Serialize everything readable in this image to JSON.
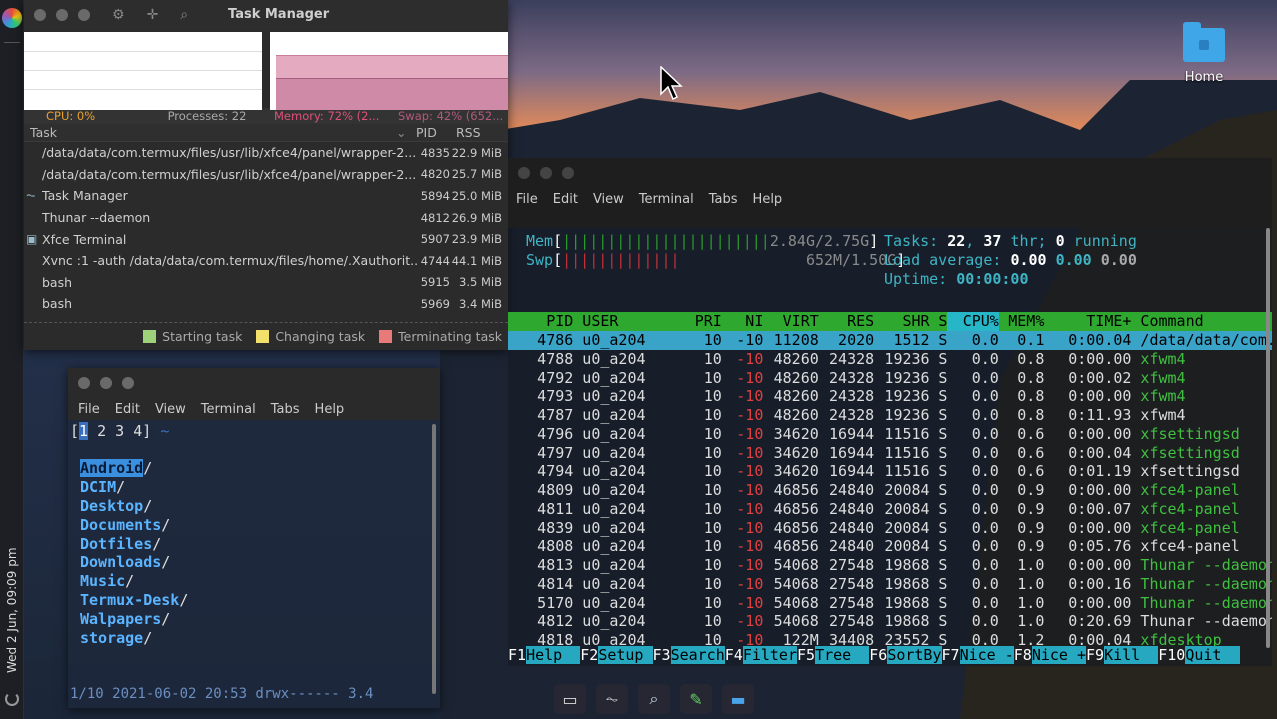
{
  "desktop": {
    "home_label": "Home"
  },
  "panel": {
    "clock": "Wed 2 Jun, 09:09 pm"
  },
  "taskmanager": {
    "title": "Task Manager",
    "status": {
      "cpu": "CPU: 0%",
      "processes": "Processes: 22",
      "memory": "Memory: 72% (2...",
      "swap": "Swap: 42% (652..."
    },
    "memory_fraction": 0.72,
    "swap_fraction": 0.42,
    "columns": {
      "task": "Task",
      "pid": "PID",
      "rss": "RSS"
    },
    "rows": [
      {
        "icon": "",
        "name": "/data/data/com.termux/files/usr/lib/xfce4/panel/wrapper-2...",
        "pid": "4835",
        "rss": "22.9 MiB"
      },
      {
        "icon": "",
        "name": "/data/data/com.termux/files/usr/lib/xfce4/panel/wrapper-2...",
        "pid": "4820",
        "rss": "25.7 MiB"
      },
      {
        "icon": "task-manager-icon",
        "name": "Task Manager",
        "pid": "5894",
        "rss": "25.0 MiB"
      },
      {
        "icon": "",
        "name": "Thunar --daemon",
        "pid": "4812",
        "rss": "26.9 MiB"
      },
      {
        "icon": "terminal-icon",
        "name": "Xfce Terminal",
        "pid": "5907",
        "rss": "23.9 MiB"
      },
      {
        "icon": "",
        "name": "Xvnc :1 -auth /data/data/com.termux/files/home/.Xauthorit...",
        "pid": "4744",
        "rss": "44.1 MiB"
      },
      {
        "icon": "",
        "name": "bash",
        "pid": "5915",
        "rss": "3.5 MiB"
      },
      {
        "icon": "",
        "name": "bash",
        "pid": "5969",
        "rss": "3.4 MiB"
      }
    ],
    "legend": {
      "starting": "Starting task",
      "changing": "Changing task",
      "terminating": "Terminating task",
      "colors": {
        "starting": "#9ed27a",
        "changing": "#f2e06a",
        "terminating": "#e87a7a"
      }
    }
  },
  "terminal_small": {
    "menu": [
      "File",
      "Edit",
      "View",
      "Terminal",
      "Tabs",
      "Help"
    ],
    "tabs": [
      "1",
      "2",
      "3",
      "4"
    ],
    "tab_suffix": "~",
    "dirs": [
      "Android",
      "DCIM",
      "Desktop",
      "Documents",
      "Dotfiles",
      "Downloads",
      "Music",
      "Termux-Desk",
      "Walpapers",
      "storage"
    ],
    "status": "1/10 2021-06-02 20:53 drwx------ 3.4"
  },
  "htop": {
    "menu": [
      "File",
      "Edit",
      "View",
      "Terminal",
      "Tabs",
      "Help"
    ],
    "mem": {
      "label": "Mem",
      "value": "2.84G/2.75G"
    },
    "swp": {
      "label": "Swp",
      "value": "652M/1.50G"
    },
    "tasks": {
      "label": "Tasks:",
      "count": "22",
      "thr": "37",
      "thr_label": "thr;",
      "running": "0",
      "running_label": "running"
    },
    "load": {
      "label": "Load average:",
      "v1": "0.00",
      "v2": "0.00",
      "v3": "0.00"
    },
    "uptime": {
      "label": "Uptime:",
      "value": "00:00:00"
    },
    "columns": [
      "PID",
      "USER",
      "PRI",
      "NI",
      "VIRT",
      "RES",
      "SHR",
      "S",
      "CPU%",
      "MEM%",
      "TIME+",
      "Command"
    ],
    "processes": [
      {
        "pid": "4786",
        "user": "u0_a204",
        "pri": "10",
        "ni": "-10",
        "virt": "11208",
        "res": "2020",
        "shr": "1512",
        "s": "S",
        "cpu": "0.0",
        "mem": "0.1",
        "time": "0:00.04",
        "cmd": "/data/data/com.",
        "cmd_color": "white"
      },
      {
        "pid": "4788",
        "user": "u0_a204",
        "pri": "10",
        "ni": "-10",
        "virt": "48260",
        "res": "24328",
        "shr": "19236",
        "s": "S",
        "cpu": "0.0",
        "mem": "0.8",
        "time": "0:00.00",
        "cmd": "xfwm4",
        "cmd_color": "green"
      },
      {
        "pid": "4792",
        "user": "u0_a204",
        "pri": "10",
        "ni": "-10",
        "virt": "48260",
        "res": "24328",
        "shr": "19236",
        "s": "S",
        "cpu": "0.0",
        "mem": "0.8",
        "time": "0:00.02",
        "cmd": "xfwm4",
        "cmd_color": "green"
      },
      {
        "pid": "4793",
        "user": "u0_a204",
        "pri": "10",
        "ni": "-10",
        "virt": "48260",
        "res": "24328",
        "shr": "19236",
        "s": "S",
        "cpu": "0.0",
        "mem": "0.8",
        "time": "0:00.00",
        "cmd": "xfwm4",
        "cmd_color": "green"
      },
      {
        "pid": "4787",
        "user": "u0_a204",
        "pri": "10",
        "ni": "-10",
        "virt": "48260",
        "res": "24328",
        "shr": "19236",
        "s": "S",
        "cpu": "0.0",
        "mem": "0.8",
        "time": "0:11.93",
        "cmd": "xfwm4",
        "cmd_color": "white"
      },
      {
        "pid": "4796",
        "user": "u0_a204",
        "pri": "10",
        "ni": "-10",
        "virt": "34620",
        "res": "16944",
        "shr": "11516",
        "s": "S",
        "cpu": "0.0",
        "mem": "0.6",
        "time": "0:00.00",
        "cmd": "xfsettingsd",
        "cmd_color": "green"
      },
      {
        "pid": "4797",
        "user": "u0_a204",
        "pri": "10",
        "ni": "-10",
        "virt": "34620",
        "res": "16944",
        "shr": "11516",
        "s": "S",
        "cpu": "0.0",
        "mem": "0.6",
        "time": "0:00.04",
        "cmd": "xfsettingsd",
        "cmd_color": "green"
      },
      {
        "pid": "4794",
        "user": "u0_a204",
        "pri": "10",
        "ni": "-10",
        "virt": "34620",
        "res": "16944",
        "shr": "11516",
        "s": "S",
        "cpu": "0.0",
        "mem": "0.6",
        "time": "0:01.19",
        "cmd": "xfsettingsd",
        "cmd_color": "white"
      },
      {
        "pid": "4809",
        "user": "u0_a204",
        "pri": "10",
        "ni": "-10",
        "virt": "46856",
        "res": "24840",
        "shr": "20084",
        "s": "S",
        "cpu": "0.0",
        "mem": "0.9",
        "time": "0:00.00",
        "cmd": "xfce4-panel",
        "cmd_color": "green"
      },
      {
        "pid": "4811",
        "user": "u0_a204",
        "pri": "10",
        "ni": "-10",
        "virt": "46856",
        "res": "24840",
        "shr": "20084",
        "s": "S",
        "cpu": "0.0",
        "mem": "0.9",
        "time": "0:00.07",
        "cmd": "xfce4-panel",
        "cmd_color": "green"
      },
      {
        "pid": "4839",
        "user": "u0_a204",
        "pri": "10",
        "ni": "-10",
        "virt": "46856",
        "res": "24840",
        "shr": "20084",
        "s": "S",
        "cpu": "0.0",
        "mem": "0.9",
        "time": "0:00.00",
        "cmd": "xfce4-panel",
        "cmd_color": "green"
      },
      {
        "pid": "4808",
        "user": "u0_a204",
        "pri": "10",
        "ni": "-10",
        "virt": "46856",
        "res": "24840",
        "shr": "20084",
        "s": "S",
        "cpu": "0.0",
        "mem": "0.9",
        "time": "0:05.76",
        "cmd": "xfce4-panel",
        "cmd_color": "white"
      },
      {
        "pid": "4813",
        "user": "u0_a204",
        "pri": "10",
        "ni": "-10",
        "virt": "54068",
        "res": "27548",
        "shr": "19868",
        "s": "S",
        "cpu": "0.0",
        "mem": "1.0",
        "time": "0:00.00",
        "cmd": "Thunar --daemon",
        "cmd_color": "green"
      },
      {
        "pid": "4814",
        "user": "u0_a204",
        "pri": "10",
        "ni": "-10",
        "virt": "54068",
        "res": "27548",
        "shr": "19868",
        "s": "S",
        "cpu": "0.0",
        "mem": "1.0",
        "time": "0:00.16",
        "cmd": "Thunar --daemon",
        "cmd_color": "green"
      },
      {
        "pid": "5170",
        "user": "u0_a204",
        "pri": "10",
        "ni": "-10",
        "virt": "54068",
        "res": "27548",
        "shr": "19868",
        "s": "S",
        "cpu": "0.0",
        "mem": "1.0",
        "time": "0:00.00",
        "cmd": "Thunar --daemon",
        "cmd_color": "green"
      },
      {
        "pid": "4812",
        "user": "u0_a204",
        "pri": "10",
        "ni": "-10",
        "virt": "54068",
        "res": "27548",
        "shr": "19868",
        "s": "S",
        "cpu": "0.0",
        "mem": "1.0",
        "time": "0:20.69",
        "cmd": "Thunar --daemon",
        "cmd_color": "white"
      },
      {
        "pid": "4818",
        "user": "u0_a204",
        "pri": "10",
        "ni": "-10",
        "virt": "122M",
        "res": "34408",
        "shr": "23552",
        "s": "S",
        "cpu": "0.0",
        "mem": "1.2",
        "time": "0:00.04",
        "cmd": "xfdesktop",
        "cmd_color": "green"
      }
    ],
    "fkeys": [
      {
        "key": "F1",
        "label": "Help  "
      },
      {
        "key": "F2",
        "label": "Setup "
      },
      {
        "key": "F3",
        "label": "Search"
      },
      {
        "key": "F4",
        "label": "Filter"
      },
      {
        "key": "F5",
        "label": "Tree  "
      },
      {
        "key": "F6",
        "label": "SortBy"
      },
      {
        "key": "F7",
        "label": "Nice -"
      },
      {
        "key": "F8",
        "label": "Nice +"
      },
      {
        "key": "F9",
        "label": "Kill  "
      },
      {
        "key": "F10",
        "label": "Quit  "
      }
    ]
  },
  "dock": [
    "terminal-icon",
    "task-manager-icon",
    "search-icon",
    "editor-icon",
    "folder-icon"
  ]
}
